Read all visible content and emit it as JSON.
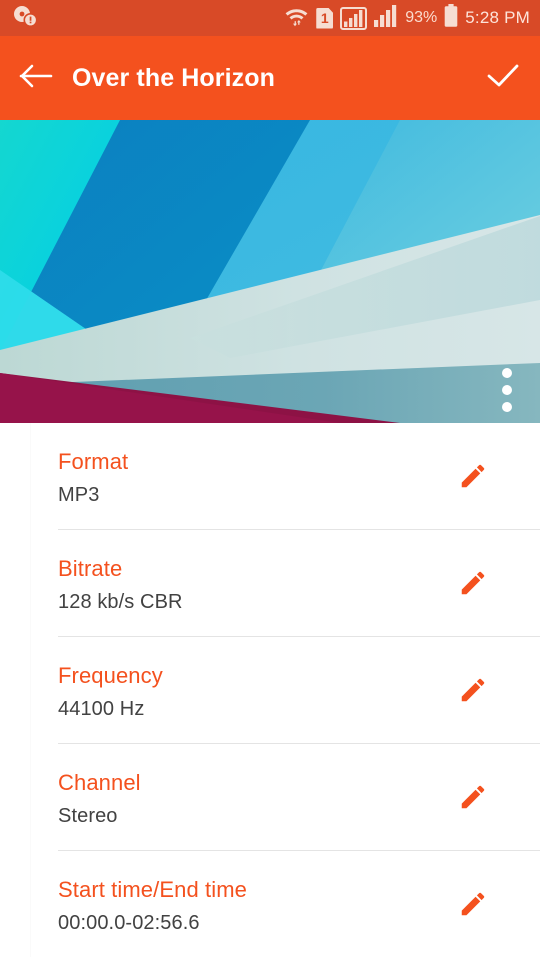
{
  "statusbar": {
    "left_icon": "disc-alert-icon",
    "icons": [
      "wifi-icon",
      "sim1-icon",
      "signal-bars-boxed-icon",
      "signal-bars-icon",
      "battery-icon"
    ],
    "sim_label": "1",
    "battery_percent": "93%",
    "time": "5:28 PM",
    "bg_color": "#d84a27"
  },
  "appbar": {
    "back_icon": "back-arrow-icon",
    "title": "Over the Horizon",
    "done_icon": "check-icon",
    "bg_color": "#f4511e"
  },
  "hero": {
    "overflow_icon": "more-vertical-icon",
    "alt": "album-artwork"
  },
  "list": {
    "accent_color": "#f4511e",
    "value_color": "#424242",
    "edit_icon": "pencil-icon",
    "items": [
      {
        "label": "Format",
        "value": "MP3"
      },
      {
        "label": "Bitrate",
        "value": "128 kb/s CBR"
      },
      {
        "label": "Frequency",
        "value": "44100 Hz"
      },
      {
        "label": "Channel",
        "value": "Stereo"
      },
      {
        "label": "Start time/End time",
        "value": "00:00.0-02:56.6"
      }
    ]
  }
}
